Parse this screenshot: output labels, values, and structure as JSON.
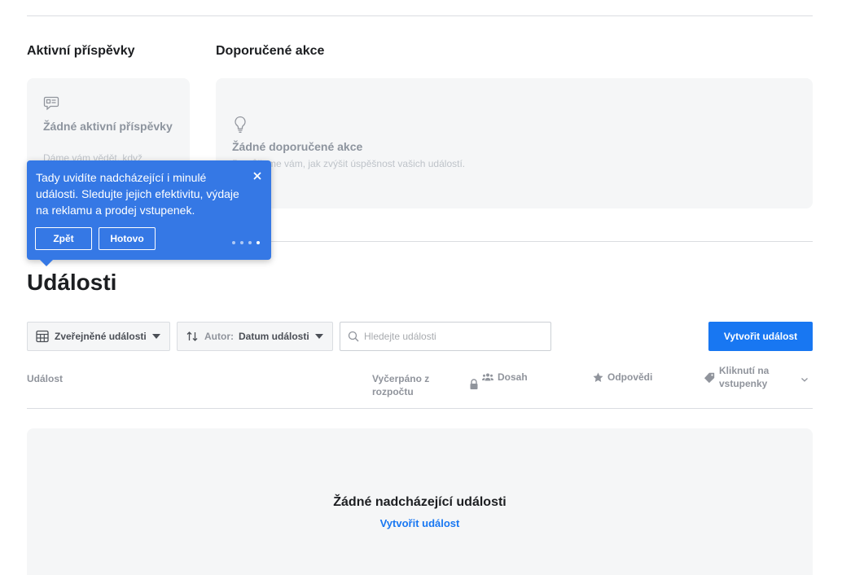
{
  "sections": {
    "active_posts": {
      "heading": "Aktivní příspěvky",
      "empty_title": "Žádné aktivní příspěvky",
      "empty_sub": "Dáme vám vědět, když"
    },
    "recommended": {
      "heading": "Doporučené akce",
      "empty_title": "Žádné doporučené akce",
      "empty_sub": "Pomůžeme vám, jak zvýšit úspěšnost vašich událostí."
    }
  },
  "tooltip": {
    "text": "Tady uvidíte nadcházející i minulé události. Sledujte jejich efektivitu, výdaje na reklamu a prodej vstupenek.",
    "back_label": "Zpět",
    "done_label": "Hotovo",
    "step": 4,
    "steps_total": 4
  },
  "events": {
    "title": "Události",
    "filter_label": "Zveřejněné události",
    "sort_prefix": "Autor:",
    "sort_value": "Datum události",
    "search_placeholder": "Hledejte události",
    "create_button": "Vytvořit událost"
  },
  "table": {
    "col_event": "Událost",
    "col_spent": "Vyčerpáno z rozpočtu",
    "col_reach": "Dosah",
    "col_answers": "Odpovědi",
    "col_tickets": "Kliknutí na vstupenky"
  },
  "empty_state": {
    "title": "Žádné nadcházející události",
    "link": "Vytvořit událost"
  },
  "colors": {
    "accent": "#1877f2",
    "tooltip_bg": "#3578e5",
    "card_bg": "#f5f6f7"
  },
  "icons": [
    "post-icon",
    "lightbulb-icon",
    "close-icon",
    "calendar-grid-icon",
    "sort-icon",
    "search-icon",
    "lock-icon",
    "people-icon",
    "star-icon",
    "ticket-icon",
    "chevron-down-icon"
  ]
}
